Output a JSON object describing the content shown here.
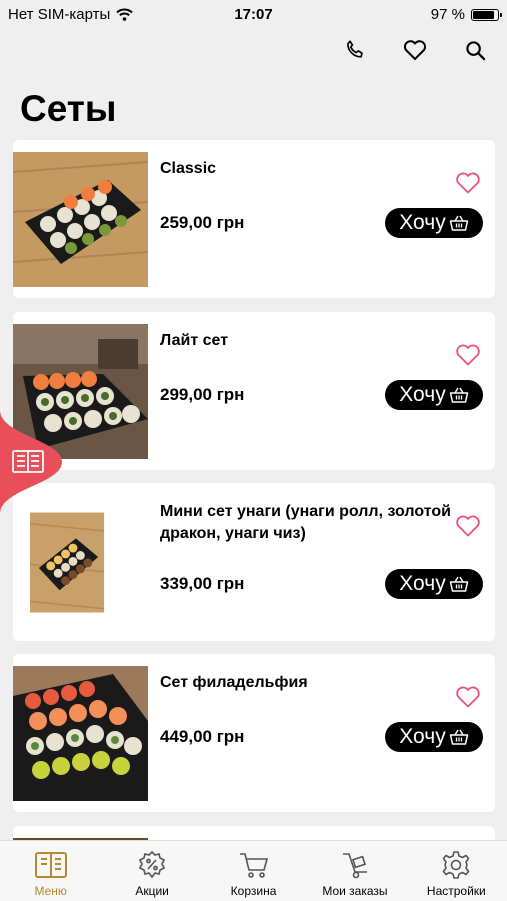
{
  "status": {
    "carrier": "Нет SIM-карты",
    "time": "17:07",
    "battery": "97 %",
    "battery_level": 0.97
  },
  "header": {
    "icons": [
      "phone-icon",
      "heart-icon",
      "search-icon"
    ]
  },
  "page": {
    "title": "Сеты"
  },
  "want_label": "Хочу",
  "products": [
    {
      "name": "Classic",
      "price": "259,00 грн"
    },
    {
      "name": "Лайт сет",
      "price": "299,00 грн"
    },
    {
      "name": "Мини сет унаги (унаги ролл, золотой дракон, унаги чиз)",
      "price": "339,00 грн"
    },
    {
      "name": "Сет филадельфия",
      "price": "449,00 грн"
    }
  ],
  "tabbar": {
    "items": [
      {
        "label": "Меню",
        "icon": "menu-book-icon",
        "active": true
      },
      {
        "label": "Акции",
        "icon": "discount-badge-icon",
        "active": false
      },
      {
        "label": "Корзина",
        "icon": "cart-icon",
        "active": false
      },
      {
        "label": "Мои заказы",
        "icon": "hand-truck-icon",
        "active": false
      },
      {
        "label": "Настройки",
        "icon": "gear-icon",
        "active": false
      }
    ],
    "active_color": "#b8882e"
  },
  "colors": {
    "accent_red": "#e84f5b",
    "heart_pink": "#e8567a",
    "button_black": "#000000"
  }
}
